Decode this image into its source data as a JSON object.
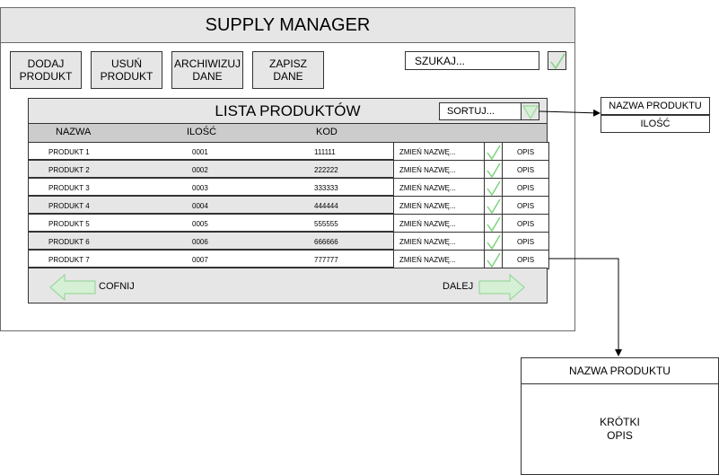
{
  "app": {
    "title": "SUPPLY MANAGER"
  },
  "toolbar": {
    "add_label": "DODAJ\nPRODUKT",
    "delete_label": "USUŃ\nPRODUKT",
    "archive_label": "ARCHIWIZUJ\nDANE",
    "save_label": "ZAPISZ\nDANE"
  },
  "search": {
    "value": "SZUKAJ..."
  },
  "list": {
    "title": "LISTA PRODUKTÓW",
    "sort_value": "SORTUJ...",
    "columns": [
      "NAZWA",
      "ILOŚĆ",
      "KOD"
    ],
    "rows": [
      {
        "name": "PRODUKT 1",
        "qty": "0001",
        "code": "111111",
        "rename": "ZMIEŃ NAZWĘ...",
        "desc": "OPIS"
      },
      {
        "name": "PRODUKT 2",
        "qty": "0002",
        "code": "222222",
        "rename": "ZMIEŃ NAZWĘ...",
        "desc": "OPIS"
      },
      {
        "name": "PRODUKT 3",
        "qty": "0003",
        "code": "333333",
        "rename": "ZMIEŃ NAZWĘ...",
        "desc": "OPIS"
      },
      {
        "name": "PRODUKT 4",
        "qty": "0004",
        "code": "444444",
        "rename": "ZMIEŃ NAZWĘ...",
        "desc": "OPIS"
      },
      {
        "name": "PRODUKT 5",
        "qty": "0005",
        "code": "555555",
        "rename": "ZMIEŃ NAZWĘ...",
        "desc": "OPIS"
      },
      {
        "name": "PRODUKT 6",
        "qty": "0006",
        "code": "666666",
        "rename": "ZMIEŃ NAZWĘ...",
        "desc": "OPIS"
      },
      {
        "name": "PRODUKT 7",
        "qty": "0007",
        "code": "777777",
        "rename": "ZMIEŃ NAZWĘ...",
        "desc": "OPIS"
      }
    ],
    "back_label": "COFNIJ",
    "next_label": "DALEJ"
  },
  "sort_options": {
    "option_1": "NAZWA PRODUKTU",
    "option_2": "ILOŚĆ"
  },
  "detail": {
    "title": "NAZWA PRODUKTU",
    "body": "KRÓTKI\nOPIS"
  },
  "colors": {
    "check_green": "#7dd37d",
    "arrow_fill": "#d5f0d5",
    "arrow_stroke": "#8fd48f",
    "gray": "#e6e6e6"
  }
}
